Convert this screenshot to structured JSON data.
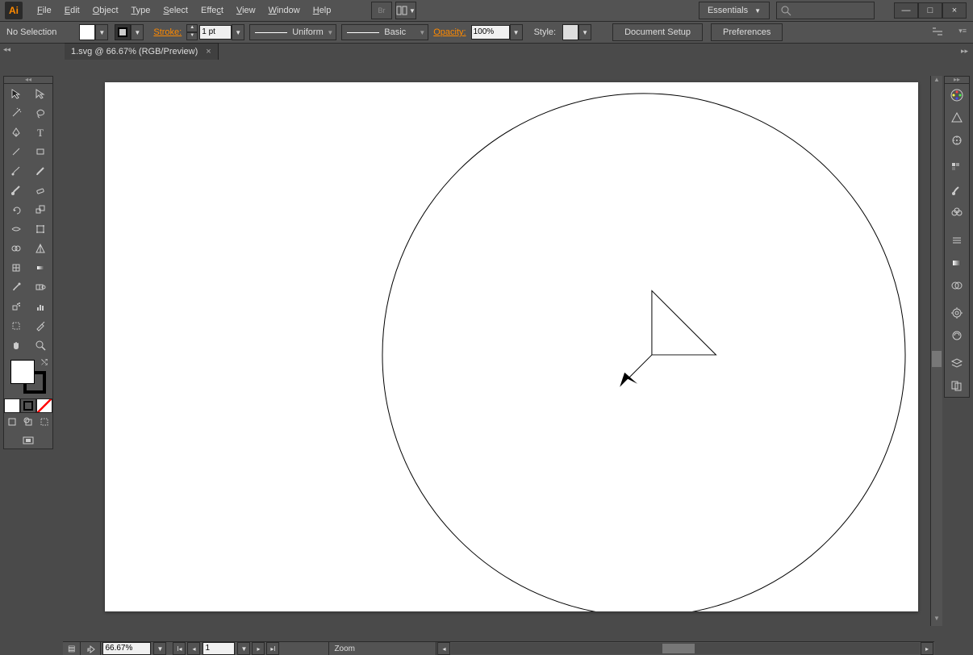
{
  "app": {
    "logo": "Ai"
  },
  "menus": [
    "File",
    "Edit",
    "Object",
    "Type",
    "Select",
    "Effect",
    "View",
    "Window",
    "Help"
  ],
  "workspace": {
    "label": "Essentials"
  },
  "window_buttons": {
    "min": "—",
    "max": "□",
    "close": "×"
  },
  "control": {
    "selection": "No Selection",
    "stroke_label": "Stroke:",
    "stroke_value": "1 pt",
    "profile_label": "Uniform",
    "brush_label": "Basic",
    "opacity_label": "Opacity:",
    "opacity_value": "100%",
    "style_label": "Style:",
    "doc_setup": "Document Setup",
    "preferences": "Preferences"
  },
  "document_tab": {
    "title": "1.svg @ 66.67% (RGB/Preview)"
  },
  "status": {
    "zoom": "66.67%",
    "page": "1",
    "tool": "Zoom"
  },
  "tools": {
    "screen_mode": "Screen"
  }
}
